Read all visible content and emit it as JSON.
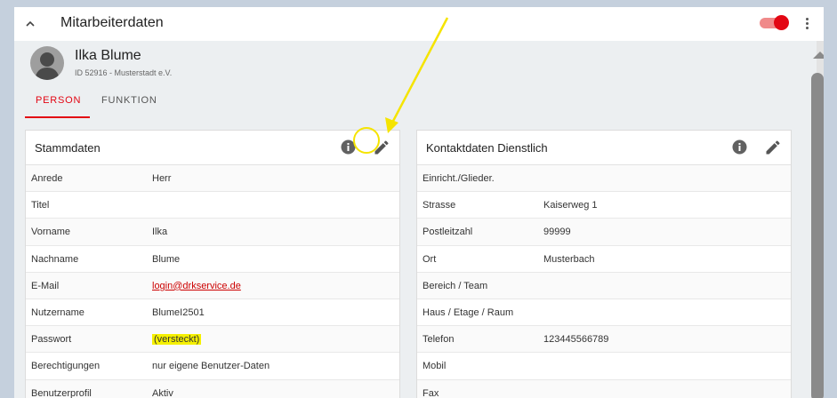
{
  "header": {
    "title": "Mitarbeiterdaten"
  },
  "profile": {
    "name": "Ilka Blume",
    "sub": "ID 52916 - Musterstadt e.V."
  },
  "tabs": [
    {
      "label": "PERSON"
    },
    {
      "label": "FUNKTION"
    }
  ],
  "stammdaten": {
    "title": "Stammdaten",
    "rows": [
      {
        "label": "Anrede",
        "value": "Herr"
      },
      {
        "label": "Titel",
        "value": ""
      },
      {
        "label": "Vorname",
        "value": "Ilka"
      },
      {
        "label": "Nachname",
        "value": "Blume"
      },
      {
        "label": "E-Mail",
        "value": "login@drkservice.de"
      },
      {
        "label": "Nutzername",
        "value": "BlumeI2501"
      },
      {
        "label": "Passwort",
        "value": "(versteckt)"
      },
      {
        "label": "Berechtigungen",
        "value": "nur eigene Benutzer-Daten"
      },
      {
        "label": "Benutzerprofil",
        "value": "Aktiv"
      }
    ]
  },
  "kontakt": {
    "title": "Kontaktdaten Dienstlich",
    "rows": [
      {
        "label": "Einricht./Glieder.",
        "value": ""
      },
      {
        "label": "Strasse",
        "value": "Kaiserweg 1"
      },
      {
        "label": "Postleitzahl",
        "value": "99999"
      },
      {
        "label": "Ort",
        "value": "Musterbach"
      },
      {
        "label": "Bereich / Team",
        "value": ""
      },
      {
        "label": "Haus / Etage / Raum",
        "value": ""
      },
      {
        "label": "Telefon",
        "value": "123445566789"
      },
      {
        "label": "Mobil",
        "value": ""
      },
      {
        "label": "Fax",
        "value": ""
      }
    ]
  },
  "colors": {
    "accent": "#e30613",
    "highlight": "#f5f000",
    "annotation": "#f5e400"
  },
  "icons": [
    "chevron-up-icon",
    "toggle-switch",
    "kebab-icon",
    "avatar-icon",
    "info-icon",
    "pencil-icon"
  ]
}
